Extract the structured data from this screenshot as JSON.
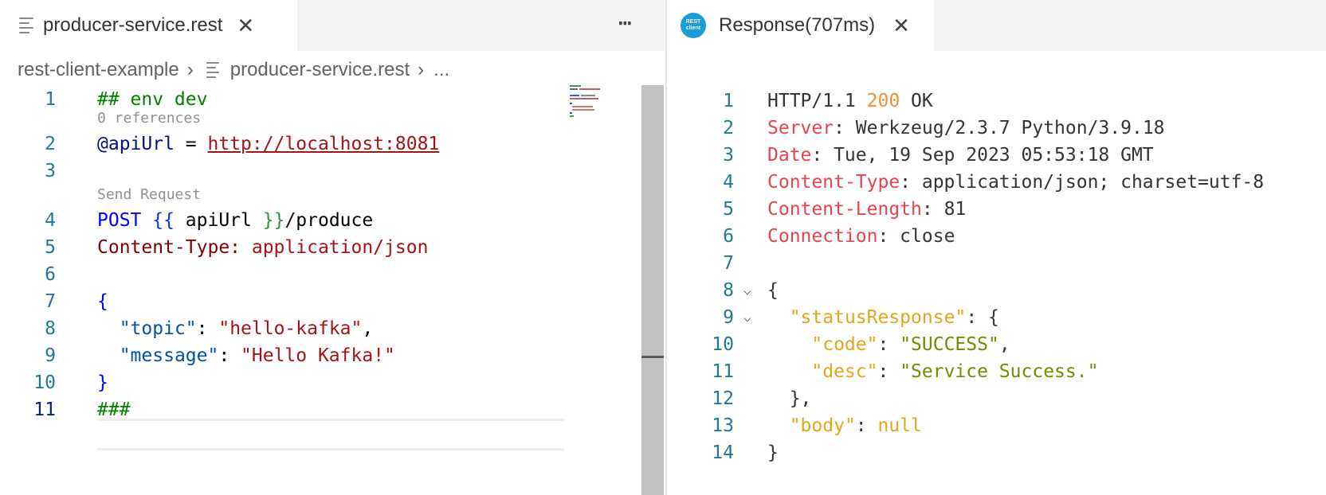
{
  "left_tab": {
    "label": "producer-service.rest",
    "file_icon": "file-lines-icon",
    "close_icon": "close-icon"
  },
  "more_icon": "⋯",
  "breadcrumb": {
    "folder": "rest-client-example",
    "file": "producer-service.rest",
    "ellipsis": "..."
  },
  "codelens": {
    "references": "0 references",
    "send_request": "Send Request"
  },
  "left_lines": [
    {
      "number": "1",
      "text": "## env dev"
    },
    {
      "number": "2",
      "var": "@apiUrl",
      "eq": " = ",
      "url": "http://localhost:8081"
    },
    {
      "number": "3"
    },
    {
      "number": "4",
      "method": "POST",
      "open": "{{",
      "var": " apiUrl ",
      "close": "}}",
      "path": "/produce"
    },
    {
      "number": "5",
      "header": "Content-Type:",
      "value": " application/json"
    },
    {
      "number": "6"
    },
    {
      "number": "7",
      "text": "{"
    },
    {
      "number": "8",
      "key": "\"topic\"",
      "sep": ": ",
      "value": "\"hello-kafka\"",
      "end": ","
    },
    {
      "number": "9",
      "key": "\"message\"",
      "sep": ": ",
      "value": "\"Hello Kafka!\""
    },
    {
      "number": "10",
      "text": "}"
    },
    {
      "number": "11",
      "text": "###"
    }
  ],
  "right_tab": {
    "label": "Response(707ms)",
    "icon_text_1": "REST",
    "icon_text_2": "client",
    "close_icon": "close-icon"
  },
  "right_lines": [
    {
      "number": "1",
      "proto": "HTTP/1.1 ",
      "status": "200",
      "reason": " OK"
    },
    {
      "number": "2",
      "name": "Server",
      "value": ": Werkzeug/2.3.7 Python/3.9.18"
    },
    {
      "number": "3",
      "name": "Date",
      "value": ": Tue, 19 Sep 2023 05:53:18 GMT"
    },
    {
      "number": "4",
      "name": "Content-Type",
      "value": ": application/json; charset=utf-8"
    },
    {
      "number": "5",
      "name": "Content-Length",
      "value": ": 81"
    },
    {
      "number": "6",
      "name": "Connection",
      "value": ": close"
    },
    {
      "number": "7"
    },
    {
      "number": "8",
      "text": "{"
    },
    {
      "number": "9",
      "key": "\"statusResponse\"",
      "rest": ": {"
    },
    {
      "number": "10",
      "key": "\"code\"",
      "sep": ": ",
      "value": "\"SUCCESS\"",
      "end": ","
    },
    {
      "number": "11",
      "key": "\"desc\"",
      "sep": ": ",
      "value": "\"Service Success.\""
    },
    {
      "number": "12",
      "text": "},"
    },
    {
      "number": "13",
      "key": "\"body\"",
      "sep": ": ",
      "value": "null"
    },
    {
      "number": "14",
      "text": "}"
    }
  ],
  "fold_icon": "⌵",
  "colors": {
    "tab_bar_bg": "#f3f3f3",
    "line_number": "#237893",
    "active_line_number": "#0b216f",
    "rest_icon": "#1a9cd8",
    "status_code": "#f78c33",
    "response_header": "#e5454c",
    "json_key": "#e2a61b",
    "json_string": "#718c00"
  }
}
